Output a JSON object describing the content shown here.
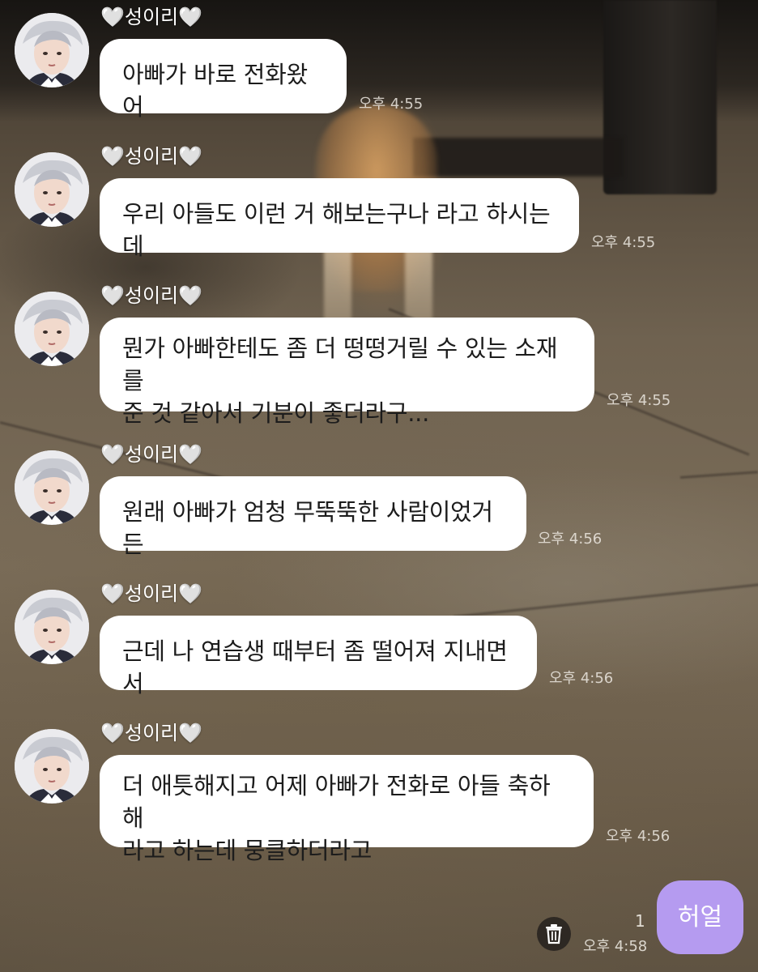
{
  "chat": {
    "messages": [
      {
        "sender": "성이리",
        "heart_left": "🤍",
        "heart_right": "🤍",
        "text": "아빠가 바로 전화왔어",
        "time": "오후 4:55"
      },
      {
        "sender": "성이리",
        "heart_left": "🤍",
        "heart_right": "🤍",
        "text": "우리 아들도 이런 거 해보는구나 라고 하시는데",
        "time": "오후 4:55"
      },
      {
        "sender": "성이리",
        "heart_left": "🤍",
        "heart_right": "🤍",
        "text": "뭔가 아빠한테도 좀 더 떵떵거릴 수 있는 소재를\n준 것 같아서 기분이 좋더라구...",
        "time": "오후 4:55"
      },
      {
        "sender": "성이리",
        "heart_left": "🤍",
        "heart_right": "🤍",
        "text": "원래 아빠가 엄청 무뚝뚝한 사람이었거든",
        "time": "오후 4:56"
      },
      {
        "sender": "성이리",
        "heart_left": "🤍",
        "heart_right": "🤍",
        "text": "근데 나 연습생 때부터 좀 떨어져 지내면서",
        "time": "오후 4:56"
      },
      {
        "sender": "성이리",
        "heart_left": "🤍",
        "heart_right": "🤍",
        "text": "더 애틋해지고 어제 아빠가 전화로 아들 축하해\n라고 하는데 뭉클하더라고",
        "time": "오후 4:56"
      }
    ],
    "outgoing": {
      "text": "허얼",
      "unread_count": "1",
      "time": "오후 4:58"
    }
  },
  "colors": {
    "incoming_bubble": "#ffffff",
    "outgoing_bubble": "#b59bf0",
    "timestamp": "#ece8e0"
  },
  "icons": {
    "delete": "trash-icon",
    "avatar": "profile-photo"
  }
}
